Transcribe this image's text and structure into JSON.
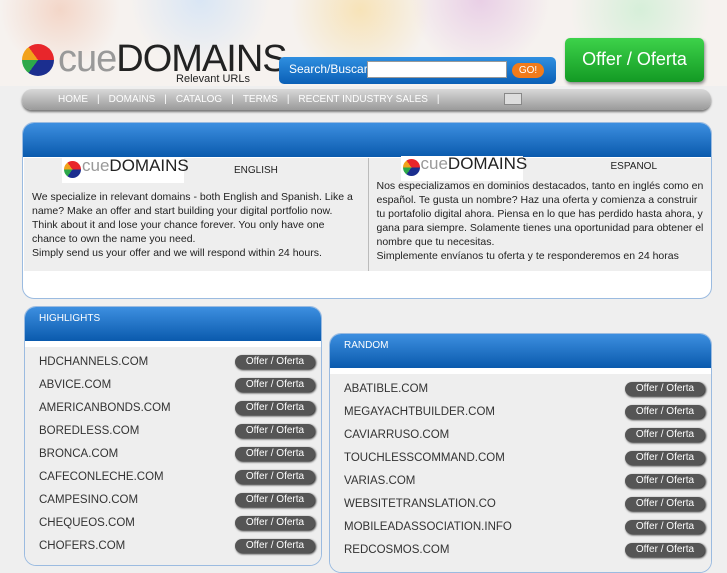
{
  "header": {
    "logo_cue": "cue",
    "logo_domains": "DOMAINS",
    "tagline": "Relevant URLs",
    "search_label": "Search/Buscar",
    "search_value": "",
    "go_label": "GO!",
    "offer_label": "Offer / Oferta"
  },
  "nav": [
    "HOME",
    "DOMAINS",
    "CATALOG",
    "TERMS",
    "RECENT INDUSTRY SALES"
  ],
  "intro": {
    "english": {
      "lang": "ENGLISH",
      "text": "We specialize in relevant domains - both English and Spanish. Like a name? Make an offer and start building your digital portfolio now. Think about it and lose your chance forever. You only have one chance to own the name you need.",
      "text2": "Simply send us your offer and we will respond within 24 hours."
    },
    "spanish": {
      "lang": "ESPANOL",
      "text": "Nos especializamos en dominios destacados, tanto en inglés como en español. Te gusta un nombre? Haz una oferta y comienza a construir tu portafolio digital ahora. Piensa en lo que has perdido hasta ahora, y gana para siempre. Solamente tienes una oportunidad para obtener el nombre que tu necesitas.",
      "text2": "Simplemente envíanos tu oferta y te responderemos en 24 horas"
    }
  },
  "offer_button": "Offer / Oferta",
  "highlights": {
    "title": "HIGHLIGHTS",
    "items": [
      "HDCHANNELS.COM",
      "ABVICE.COM",
      "AMERICANBONDS.COM",
      "BOREDLESS.COM",
      "BRONCA.COM",
      "CAFECONLECHE.COM",
      "CAMPESINO.COM",
      "CHEQUEOS.COM",
      "CHOFERS.COM"
    ]
  },
  "random": {
    "title": "RANDOM",
    "items": [
      "ABATIBLE.COM",
      "MEGAYACHTBUILDER.COM",
      "CAVIARRUSO.COM",
      "TOUCHLESSCOMMAND.COM",
      "VARIAS.COM",
      "WEBSITETRANSLATION.CO",
      "MOBILEADASSOCIATION.INFO",
      "REDCOSMOS.COM"
    ]
  }
}
